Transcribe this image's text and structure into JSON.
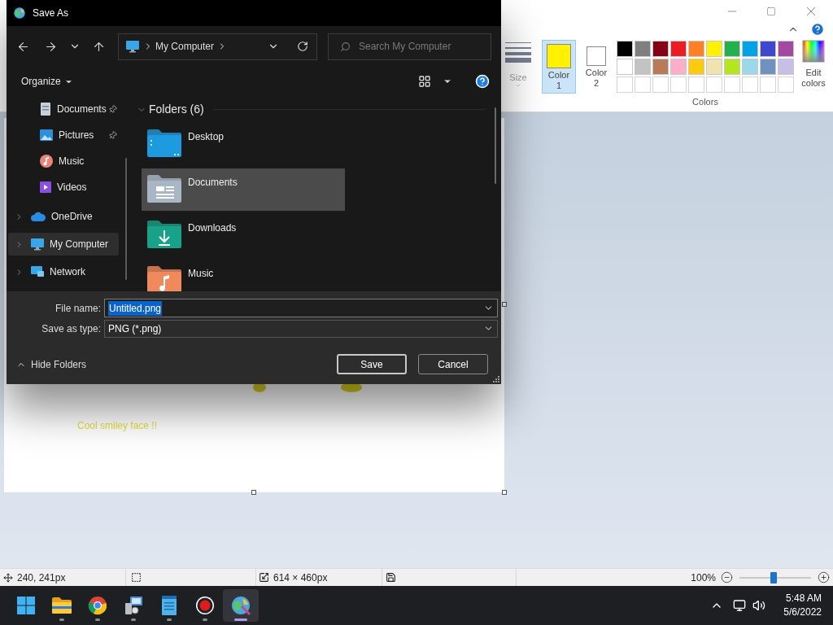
{
  "paint": {
    "ribbon": {
      "size_label": "Size",
      "active_colors": [
        {
          "label": "Color 1",
          "color": "#fff200",
          "selected": true
        },
        {
          "label": "Color 2",
          "color": "#ffffff",
          "selected": false
        }
      ],
      "swatches": [
        {
          "kind": "color",
          "color": "#000000"
        },
        {
          "kind": "color",
          "color": "#7f7f7f"
        },
        {
          "kind": "color",
          "color": "#880015"
        },
        {
          "kind": "color",
          "color": "#ed1c24"
        },
        {
          "kind": "color",
          "color": "#ff7f27"
        },
        {
          "kind": "color",
          "color": "#fff200"
        },
        {
          "kind": "color",
          "color": "#22b14c"
        },
        {
          "kind": "color",
          "color": "#00a2e8"
        },
        {
          "kind": "color",
          "color": "#3f48cc"
        },
        {
          "kind": "color",
          "color": "#a349a4"
        },
        {
          "kind": "color",
          "color": "#ffffff"
        },
        {
          "kind": "color",
          "color": "#c3c3c3"
        },
        {
          "kind": "color",
          "color": "#b97a57"
        },
        {
          "kind": "color",
          "color": "#ffaec9"
        },
        {
          "kind": "color",
          "color": "#ffc90e"
        },
        {
          "kind": "color",
          "color": "#efe4b0"
        },
        {
          "kind": "color",
          "color": "#b5e61d"
        },
        {
          "kind": "color",
          "color": "#99d9ea"
        },
        {
          "kind": "color",
          "color": "#7092be"
        },
        {
          "kind": "color",
          "color": "#c8bfe7"
        },
        {
          "kind": "empty"
        },
        {
          "kind": "empty"
        },
        {
          "kind": "empty"
        },
        {
          "kind": "empty"
        },
        {
          "kind": "empty"
        },
        {
          "kind": "empty"
        },
        {
          "kind": "empty"
        },
        {
          "kind": "empty"
        },
        {
          "kind": "empty"
        },
        {
          "kind": "empty"
        }
      ],
      "edit_colors_label": "Edit colors",
      "group_label": "Colors"
    },
    "canvas": {
      "caption": "Cool smiley face !!"
    },
    "status_bar": {
      "cursor": "240, 241px",
      "canvas_size": "614 × 460px",
      "zoom": "100%",
      "zoom_slider": {
        "level": 0.48
      }
    }
  },
  "dialog": {
    "title": "Save As",
    "address": {
      "path": "My Computer"
    },
    "search": {
      "placeholder": "Search My Computer"
    },
    "organize": "Organize",
    "nav_items": [
      {
        "label": "Documents",
        "kind": "documents",
        "pinned": true,
        "expandable": false,
        "selected": false
      },
      {
        "label": "Pictures",
        "kind": "pictures",
        "pinned": true,
        "expandable": false,
        "selected": false
      },
      {
        "label": "Music",
        "kind": "music",
        "pinned": false,
        "expandable": false,
        "selected": false
      },
      {
        "label": "Videos",
        "kind": "videos",
        "pinned": false,
        "expandable": false,
        "selected": false
      },
      {
        "label": "OneDrive",
        "kind": "cloud",
        "pinned": false,
        "expandable": true,
        "selected": false
      },
      {
        "label": "My Computer",
        "kind": "computer",
        "pinned": false,
        "expandable": true,
        "selected": true
      },
      {
        "label": "Network",
        "kind": "network",
        "pinned": false,
        "expandable": true,
        "selected": false
      }
    ],
    "folders_header": "Folders (6)",
    "folders": [
      {
        "label": "Desktop",
        "kind": "desktop",
        "selected": false
      },
      {
        "label": "Documents",
        "kind": "documents",
        "selected": true
      },
      {
        "label": "Downloads",
        "kind": "downloads",
        "selected": false
      },
      {
        "label": "Music",
        "kind": "music",
        "selected": false
      }
    ],
    "file_name": {
      "label": "File name:",
      "value": "Untitled.png",
      "text_selected": true
    },
    "save_type": {
      "label": "Save as type:",
      "value": "PNG (*.png)"
    },
    "hide_folders": "Hide Folders",
    "buttons": [
      {
        "label": "Save",
        "default": true
      },
      {
        "label": "Cancel",
        "default": false
      }
    ]
  },
  "taskbar": {
    "apps": [
      {
        "kind": "start",
        "running": false,
        "selected": false
      },
      {
        "kind": "explorer",
        "running": true,
        "selected": false
      },
      {
        "kind": "browser",
        "running": true,
        "selected": false
      },
      {
        "kind": "computer",
        "running": true,
        "selected": false
      },
      {
        "kind": "notepad",
        "running": true,
        "selected": false
      },
      {
        "kind": "record",
        "running": true,
        "selected": false
      },
      {
        "kind": "paint",
        "running": true,
        "selected": true
      }
    ],
    "time": "5:48 AM",
    "date": "5/6/2022"
  }
}
